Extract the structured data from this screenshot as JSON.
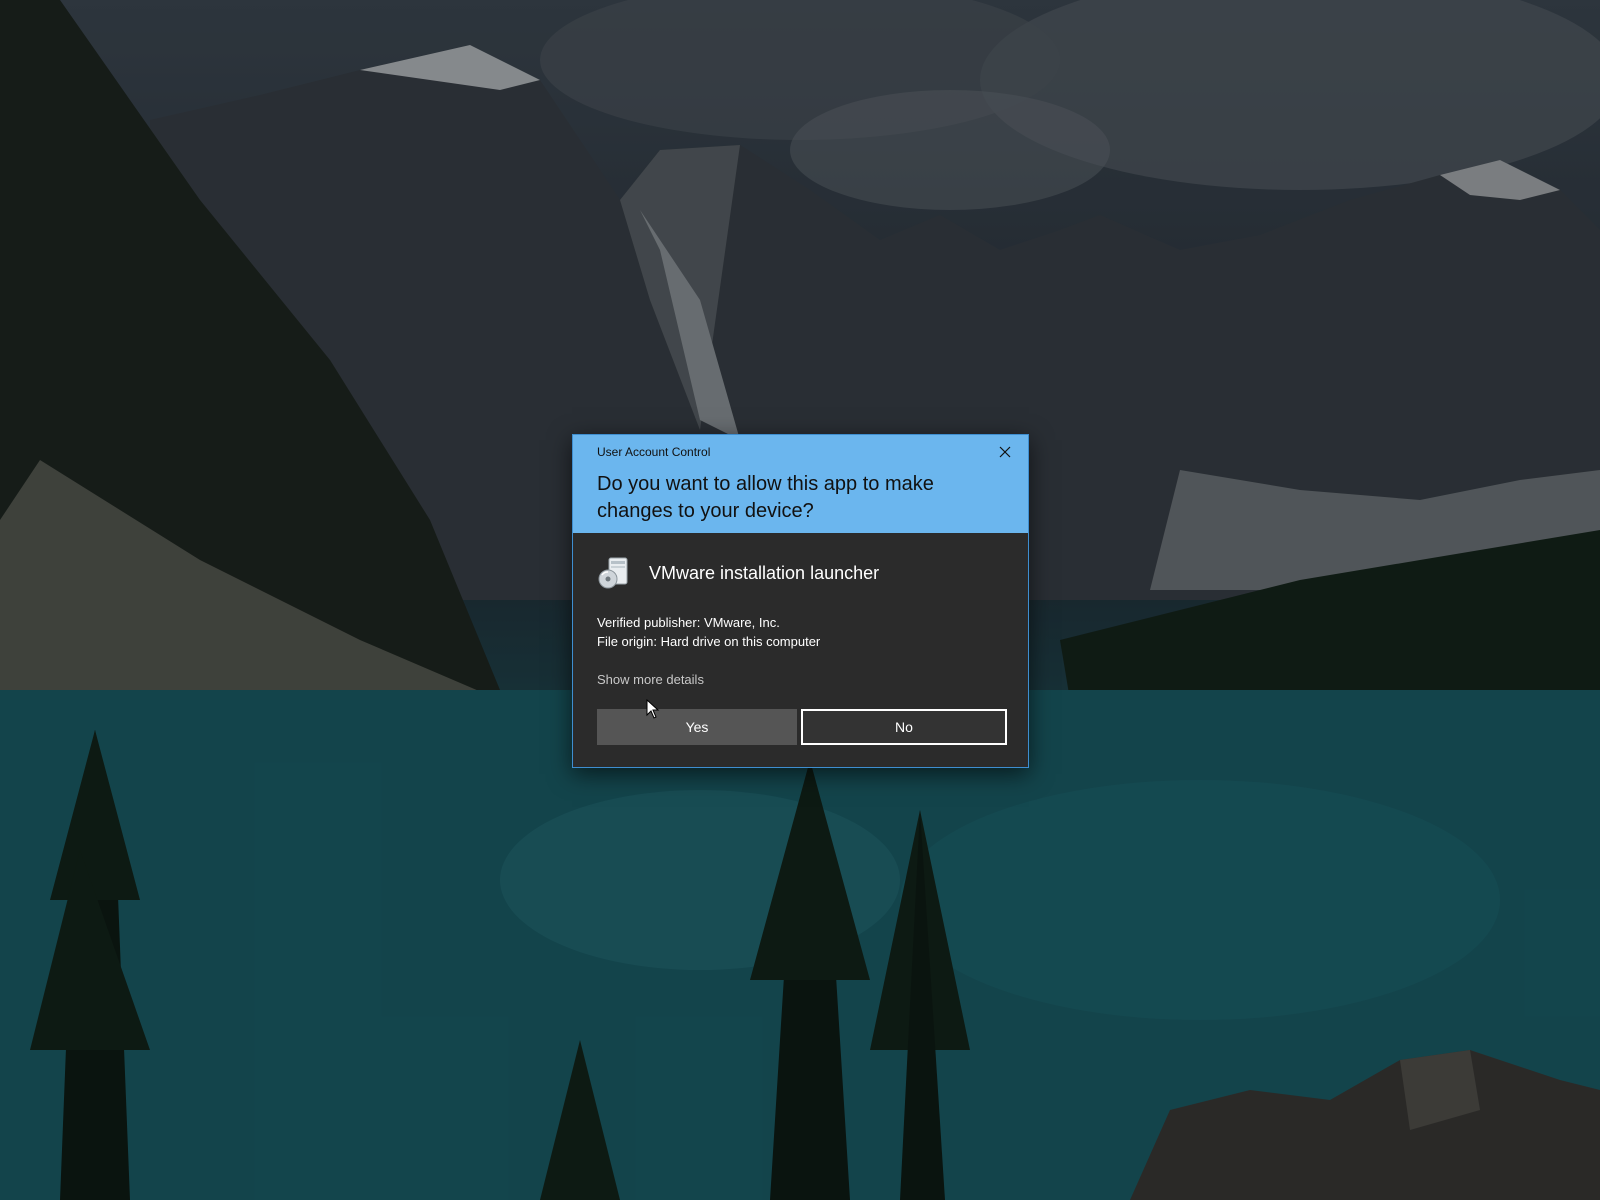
{
  "dialog": {
    "title": "User Account Control",
    "question": "Do you want to allow this app to make changes to your device?",
    "app_name": "VMware installation launcher",
    "publisher": "Verified publisher: VMware, Inc.",
    "origin": "File origin: Hard drive on this computer",
    "more_details": "Show more details",
    "yes_label": "Yes",
    "no_label": "No",
    "close_icon": "close-icon",
    "app_icon": "installer-icon"
  },
  "colors": {
    "header": "#6bb6ee",
    "body": "#2b2b2b",
    "border": "#3e8ed0",
    "yes_button": "#555555",
    "no_button": "#333333"
  }
}
